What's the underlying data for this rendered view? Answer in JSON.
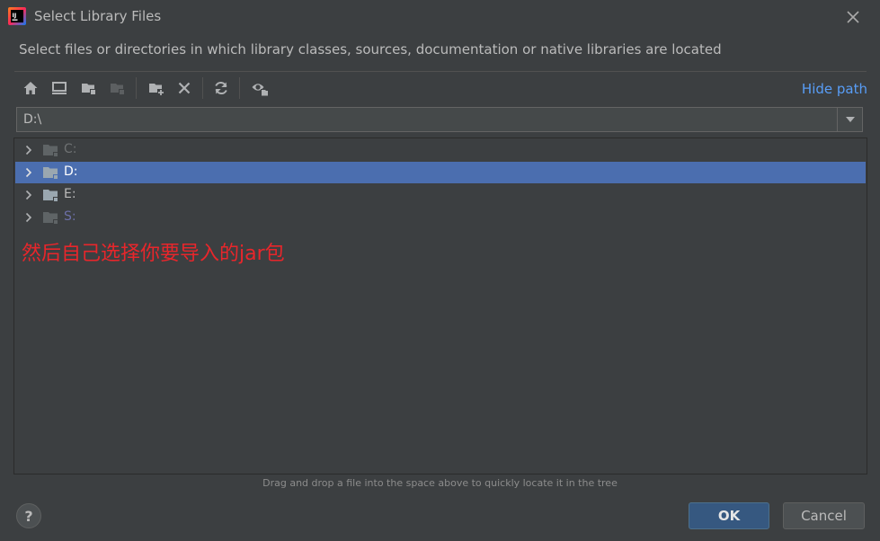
{
  "window": {
    "title": "Select Library Files",
    "app_icon": "intellij-idea-icon"
  },
  "description": "Select files or directories in which library classes, sources, documentation or native libraries are located",
  "toolbar": {
    "buttons": [
      {
        "name": "home-icon"
      },
      {
        "name": "desktop-icon"
      },
      {
        "name": "project-folder-icon"
      },
      {
        "name": "module-folder-icon"
      },
      {
        "name": "new-folder-icon"
      },
      {
        "name": "delete-icon"
      },
      {
        "name": "refresh-icon"
      },
      {
        "name": "show-hidden-icon"
      }
    ],
    "hide_path_label": "Hide path"
  },
  "path": {
    "value": "D:\\"
  },
  "tree": {
    "items": [
      {
        "label": "C:",
        "selected": false
      },
      {
        "label": "D:",
        "selected": true
      },
      {
        "label": "E:",
        "selected": false
      },
      {
        "label": "S:",
        "selected": false
      }
    ]
  },
  "annotation": "然后自己选择你要导入的jar包",
  "hint": "Drag and drop a file into the space above to quickly locate it in the tree",
  "buttons": {
    "help": "?",
    "ok": "OK",
    "cancel": "Cancel"
  },
  "colors": {
    "background": "#3c3f41",
    "selection": "#4b6eaf",
    "link": "#589df6",
    "annotation": "#e8262b",
    "ok_button": "#365880"
  }
}
